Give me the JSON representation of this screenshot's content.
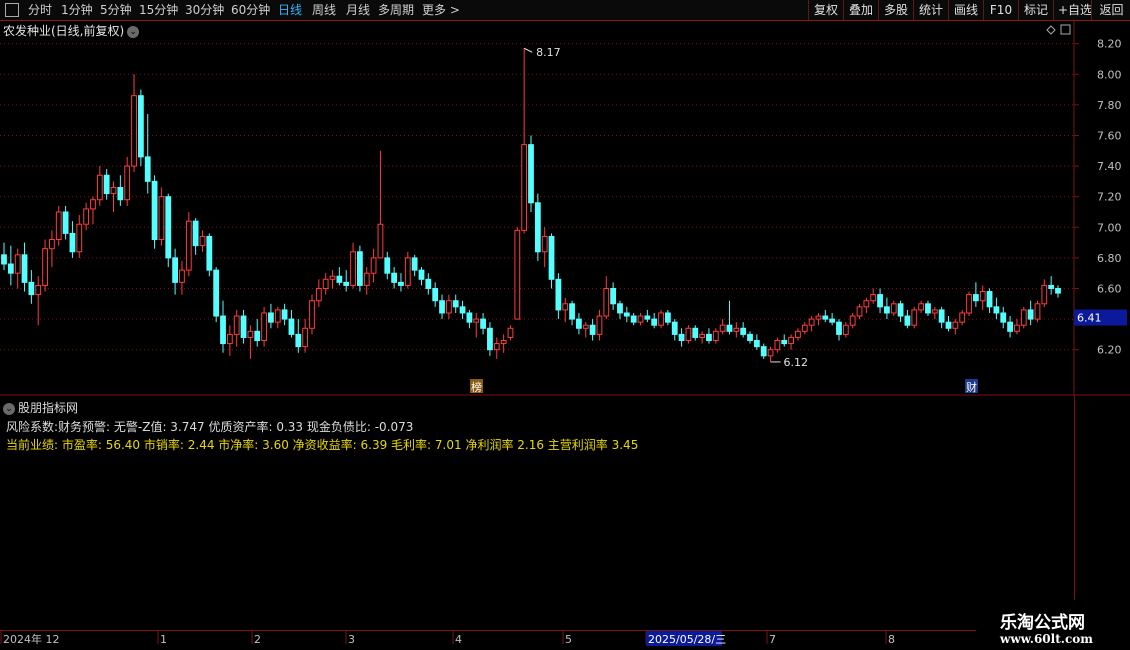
{
  "toolbar": {
    "periods": [
      "分时",
      "1分钟",
      "5分钟",
      "15分钟",
      "30分钟",
      "60分钟",
      "日线",
      "周线",
      "月线",
      "多周期",
      "更多 >"
    ],
    "active_period": "日线",
    "right_buttons": [
      "复权",
      "叠加",
      "多股",
      "统计",
      "画线",
      "F10",
      "标记",
      "+自选",
      "返回"
    ]
  },
  "chart": {
    "title": "农发种业(日线,前复权)",
    "price_axis": [
      "8.20",
      "8.00",
      "7.80",
      "7.60",
      "7.40",
      "7.20",
      "7.00",
      "6.80",
      "6.60",
      "6.40",
      "6.20"
    ],
    "current_price": "6.41",
    "high_label": "8.17",
    "low_label": "6.12",
    "marker_bang": "榜",
    "marker_cai": "财"
  },
  "indicator": {
    "title": "股朋指标网",
    "risk_line": "风险系数:财务预警: 无警-Z值: 3.747 优质资产率: 0.33 现金负债比: -0.073",
    "perf_line": "当前业绩: 市盈率: 56.40 市销率: 2.44 市净率: 3.60 净资收益率: 6.39 毛利率: 7.01 净利润率 2.16 主营利润率 3.45"
  },
  "time_axis": {
    "labels": [
      "2024年 12",
      "1",
      "2",
      "3",
      "4",
      "5",
      "2025/05/28/三",
      "7",
      "8"
    ],
    "highlight": "2025/05/28/三"
  },
  "watermark": {
    "title": "乐淘公式网",
    "url": "www.60lt.com"
  },
  "colors": {
    "up": "#ff3c3c",
    "down": "#54ffff",
    "grid": "#7a1414",
    "active": "#33b5ff",
    "perf": "#e8d800"
  },
  "chart_data": {
    "type": "candlestick",
    "ylim": [
      6.1,
      8.25
    ],
    "candles": [
      {
        "o": 6.82,
        "h": 6.9,
        "l": 6.72,
        "c": 6.76
      },
      {
        "o": 6.76,
        "h": 6.88,
        "l": 6.62,
        "c": 6.7
      },
      {
        "o": 6.7,
        "h": 6.86,
        "l": 6.6,
        "c": 6.82
      },
      {
        "o": 6.82,
        "h": 6.9,
        "l": 6.58,
        "c": 6.64
      },
      {
        "o": 6.64,
        "h": 6.72,
        "l": 6.5,
        "c": 6.56
      },
      {
        "o": 6.56,
        "h": 6.68,
        "l": 6.36,
        "c": 6.62
      },
      {
        "o": 6.62,
        "h": 6.92,
        "l": 6.58,
        "c": 6.86
      },
      {
        "o": 6.86,
        "h": 6.98,
        "l": 6.74,
        "c": 6.92
      },
      {
        "o": 6.92,
        "h": 7.14,
        "l": 6.88,
        "c": 7.1
      },
      {
        "o": 7.1,
        "h": 7.14,
        "l": 6.92,
        "c": 6.96
      },
      {
        "o": 6.96,
        "h": 7.04,
        "l": 6.8,
        "c": 6.84
      },
      {
        "o": 6.84,
        "h": 7.08,
        "l": 6.8,
        "c": 7.02
      },
      {
        "o": 7.02,
        "h": 7.16,
        "l": 6.98,
        "c": 7.12
      },
      {
        "o": 7.12,
        "h": 7.2,
        "l": 7.02,
        "c": 7.18
      },
      {
        "o": 7.18,
        "h": 7.4,
        "l": 7.14,
        "c": 7.34
      },
      {
        "o": 7.34,
        "h": 7.38,
        "l": 7.18,
        "c": 7.22
      },
      {
        "o": 7.22,
        "h": 7.3,
        "l": 7.1,
        "c": 7.26
      },
      {
        "o": 7.26,
        "h": 7.34,
        "l": 7.14,
        "c": 7.18
      },
      {
        "o": 7.18,
        "h": 7.46,
        "l": 7.14,
        "c": 7.4
      },
      {
        "o": 7.4,
        "h": 8.0,
        "l": 7.36,
        "c": 7.86
      },
      {
        "o": 7.86,
        "h": 7.9,
        "l": 7.4,
        "c": 7.46
      },
      {
        "o": 7.46,
        "h": 7.74,
        "l": 7.22,
        "c": 7.3
      },
      {
        "o": 7.3,
        "h": 7.34,
        "l": 6.86,
        "c": 6.92
      },
      {
        "o": 6.92,
        "h": 7.26,
        "l": 6.88,
        "c": 7.2
      },
      {
        "o": 7.2,
        "h": 7.22,
        "l": 6.74,
        "c": 6.8
      },
      {
        "o": 6.8,
        "h": 6.86,
        "l": 6.56,
        "c": 6.64
      },
      {
        "o": 6.64,
        "h": 6.78,
        "l": 6.56,
        "c": 6.72
      },
      {
        "o": 6.72,
        "h": 7.1,
        "l": 6.68,
        "c": 7.04
      },
      {
        "o": 7.04,
        "h": 7.06,
        "l": 6.82,
        "c": 6.88
      },
      {
        "o": 6.88,
        "h": 6.98,
        "l": 6.84,
        "c": 6.94
      },
      {
        "o": 6.94,
        "h": 6.96,
        "l": 6.68,
        "c": 6.72
      },
      {
        "o": 6.72,
        "h": 6.74,
        "l": 6.38,
        "c": 6.42
      },
      {
        "o": 6.42,
        "h": 6.52,
        "l": 6.18,
        "c": 6.24
      },
      {
        "o": 6.24,
        "h": 6.36,
        "l": 6.16,
        "c": 6.3
      },
      {
        "o": 6.3,
        "h": 6.46,
        "l": 6.22,
        "c": 6.42
      },
      {
        "o": 6.42,
        "h": 6.46,
        "l": 6.24,
        "c": 6.28
      },
      {
        "o": 6.28,
        "h": 6.36,
        "l": 6.14,
        "c": 6.32
      },
      {
        "o": 6.32,
        "h": 6.4,
        "l": 6.22,
        "c": 6.26
      },
      {
        "o": 6.26,
        "h": 6.48,
        "l": 6.22,
        "c": 6.44
      },
      {
        "o": 6.44,
        "h": 6.5,
        "l": 6.34,
        "c": 6.38
      },
      {
        "o": 6.38,
        "h": 6.48,
        "l": 6.34,
        "c": 6.46
      },
      {
        "o": 6.46,
        "h": 6.5,
        "l": 6.36,
        "c": 6.4
      },
      {
        "o": 6.4,
        "h": 6.46,
        "l": 6.28,
        "c": 6.3
      },
      {
        "o": 6.3,
        "h": 6.4,
        "l": 6.18,
        "c": 6.22
      },
      {
        "o": 6.22,
        "h": 6.4,
        "l": 6.18,
        "c": 6.34
      },
      {
        "o": 6.34,
        "h": 6.56,
        "l": 6.3,
        "c": 6.52
      },
      {
        "o": 6.52,
        "h": 6.66,
        "l": 6.48,
        "c": 6.6
      },
      {
        "o": 6.6,
        "h": 6.7,
        "l": 6.56,
        "c": 6.66
      },
      {
        "o": 6.66,
        "h": 6.72,
        "l": 6.6,
        "c": 6.68
      },
      {
        "o": 6.68,
        "h": 6.74,
        "l": 6.62,
        "c": 6.64
      },
      {
        "o": 6.64,
        "h": 6.72,
        "l": 6.58,
        "c": 6.62
      },
      {
        "o": 6.62,
        "h": 6.9,
        "l": 6.6,
        "c": 6.84
      },
      {
        "o": 6.84,
        "h": 6.88,
        "l": 6.58,
        "c": 6.62
      },
      {
        "o": 6.62,
        "h": 6.74,
        "l": 6.56,
        "c": 6.7
      },
      {
        "o": 6.7,
        "h": 6.86,
        "l": 6.64,
        "c": 6.8
      },
      {
        "o": 6.8,
        "h": 7.5,
        "l": 6.96,
        "c": 7.02
      },
      {
        "o": 6.8,
        "h": 6.84,
        "l": 6.66,
        "c": 6.7
      },
      {
        "o": 6.7,
        "h": 6.74,
        "l": 6.6,
        "c": 6.64
      },
      {
        "o": 6.64,
        "h": 6.7,
        "l": 6.58,
        "c": 6.62
      },
      {
        "o": 6.62,
        "h": 6.84,
        "l": 6.6,
        "c": 6.8
      },
      {
        "o": 6.8,
        "h": 6.82,
        "l": 6.68,
        "c": 6.72
      },
      {
        "o": 6.72,
        "h": 6.74,
        "l": 6.62,
        "c": 6.66
      },
      {
        "o": 6.66,
        "h": 6.7,
        "l": 6.56,
        "c": 6.6
      },
      {
        "o": 6.6,
        "h": 6.64,
        "l": 6.48,
        "c": 6.52
      },
      {
        "o": 6.52,
        "h": 6.56,
        "l": 6.4,
        "c": 6.44
      },
      {
        "o": 6.44,
        "h": 6.56,
        "l": 6.4,
        "c": 6.52
      },
      {
        "o": 6.52,
        "h": 6.56,
        "l": 6.44,
        "c": 6.48
      },
      {
        "o": 6.48,
        "h": 6.52,
        "l": 6.4,
        "c": 6.44
      },
      {
        "o": 6.44,
        "h": 6.46,
        "l": 6.34,
        "c": 6.38
      },
      {
        "o": 6.38,
        "h": 6.44,
        "l": 6.28,
        "c": 6.4
      },
      {
        "o": 6.4,
        "h": 6.44,
        "l": 6.3,
        "c": 6.34
      },
      {
        "o": 6.34,
        "h": 6.38,
        "l": 6.16,
        "c": 6.2
      },
      {
        "o": 6.2,
        "h": 6.28,
        "l": 6.14,
        "c": 6.24
      },
      {
        "o": 6.24,
        "h": 6.3,
        "l": 6.18,
        "c": 6.26
      },
      {
        "o": 6.28,
        "h": 6.36,
        "l": 6.26,
        "c": 6.34
      },
      {
        "o": 6.4,
        "h": 7.0,
        "l": 6.4,
        "c": 6.98
      },
      {
        "o": 6.98,
        "h": 8.17,
        "l": 6.96,
        "c": 7.54
      },
      {
        "o": 7.54,
        "h": 7.6,
        "l": 7.1,
        "c": 7.16
      },
      {
        "o": 7.16,
        "h": 7.22,
        "l": 6.78,
        "c": 6.84
      },
      {
        "o": 6.84,
        "h": 7.0,
        "l": 6.74,
        "c": 6.94
      },
      {
        "o": 6.94,
        "h": 6.96,
        "l": 6.6,
        "c": 6.66
      },
      {
        "o": 6.66,
        "h": 6.7,
        "l": 6.4,
        "c": 6.46
      },
      {
        "o": 6.46,
        "h": 6.54,
        "l": 6.38,
        "c": 6.5
      },
      {
        "o": 6.5,
        "h": 6.52,
        "l": 6.36,
        "c": 6.4
      },
      {
        "o": 6.4,
        "h": 6.44,
        "l": 6.3,
        "c": 6.34
      },
      {
        "o": 6.34,
        "h": 6.38,
        "l": 6.28,
        "c": 6.36
      },
      {
        "o": 6.36,
        "h": 6.4,
        "l": 6.26,
        "c": 6.3
      },
      {
        "o": 6.3,
        "h": 6.46,
        "l": 6.26,
        "c": 6.42
      },
      {
        "o": 6.42,
        "h": 6.68,
        "l": 6.4,
        "c": 6.6
      },
      {
        "o": 6.6,
        "h": 6.64,
        "l": 6.46,
        "c": 6.5
      },
      {
        "o": 6.5,
        "h": 6.52,
        "l": 6.4,
        "c": 6.44
      },
      {
        "o": 6.44,
        "h": 6.48,
        "l": 6.38,
        "c": 6.42
      },
      {
        "o": 6.42,
        "h": 6.44,
        "l": 6.36,
        "c": 6.38
      },
      {
        "o": 6.38,
        "h": 6.44,
        "l": 6.36,
        "c": 6.42
      },
      {
        "o": 6.42,
        "h": 6.46,
        "l": 6.38,
        "c": 6.4
      },
      {
        "o": 6.4,
        "h": 6.44,
        "l": 6.34,
        "c": 6.36
      },
      {
        "o": 6.36,
        "h": 6.46,
        "l": 6.34,
        "c": 6.44
      },
      {
        "o": 6.44,
        "h": 6.46,
        "l": 6.36,
        "c": 6.38
      },
      {
        "o": 6.38,
        "h": 6.4,
        "l": 6.26,
        "c": 6.3
      },
      {
        "o": 6.3,
        "h": 6.34,
        "l": 6.22,
        "c": 6.26
      },
      {
        "o": 6.26,
        "h": 6.36,
        "l": 6.24,
        "c": 6.34
      },
      {
        "o": 6.34,
        "h": 6.36,
        "l": 6.26,
        "c": 6.28
      },
      {
        "o": 6.28,
        "h": 6.32,
        "l": 6.24,
        "c": 6.3
      },
      {
        "o": 6.3,
        "h": 6.34,
        "l": 6.24,
        "c": 6.26
      },
      {
        "o": 6.26,
        "h": 6.34,
        "l": 6.24,
        "c": 6.32
      },
      {
        "o": 6.32,
        "h": 6.4,
        "l": 6.3,
        "c": 6.36
      },
      {
        "o": 6.36,
        "h": 6.52,
        "l": 6.3,
        "c": 6.32
      },
      {
        "o": 6.32,
        "h": 6.38,
        "l": 6.28,
        "c": 6.34
      },
      {
        "o": 6.34,
        "h": 6.38,
        "l": 6.28,
        "c": 6.3
      },
      {
        "o": 6.3,
        "h": 6.32,
        "l": 6.24,
        "c": 6.26
      },
      {
        "o": 6.26,
        "h": 6.3,
        "l": 6.2,
        "c": 6.22
      },
      {
        "o": 6.22,
        "h": 6.24,
        "l": 6.14,
        "c": 6.16
      },
      {
        "o": 6.16,
        "h": 6.22,
        "l": 6.12,
        "c": 6.2
      },
      {
        "o": 6.2,
        "h": 6.28,
        "l": 6.18,
        "c": 6.26
      },
      {
        "o": 6.26,
        "h": 6.3,
        "l": 6.22,
        "c": 6.24
      },
      {
        "o": 6.24,
        "h": 6.3,
        "l": 6.2,
        "c": 6.28
      },
      {
        "o": 6.28,
        "h": 6.34,
        "l": 6.26,
        "c": 6.32
      },
      {
        "o": 6.32,
        "h": 6.38,
        "l": 6.3,
        "c": 6.36
      },
      {
        "o": 6.36,
        "h": 6.42,
        "l": 6.32,
        "c": 6.4
      },
      {
        "o": 6.4,
        "h": 6.44,
        "l": 6.36,
        "c": 6.42
      },
      {
        "o": 6.42,
        "h": 6.46,
        "l": 6.38,
        "c": 6.4
      },
      {
        "o": 6.4,
        "h": 6.44,
        "l": 6.36,
        "c": 6.38
      },
      {
        "o": 6.38,
        "h": 6.4,
        "l": 6.26,
        "c": 6.3
      },
      {
        "o": 6.3,
        "h": 6.38,
        "l": 6.28,
        "c": 6.36
      },
      {
        "o": 6.36,
        "h": 6.44,
        "l": 6.34,
        "c": 6.42
      },
      {
        "o": 6.42,
        "h": 6.5,
        "l": 6.4,
        "c": 6.48
      },
      {
        "o": 6.48,
        "h": 6.54,
        "l": 6.44,
        "c": 6.52
      },
      {
        "o": 6.52,
        "h": 6.6,
        "l": 6.5,
        "c": 6.56
      },
      {
        "o": 6.56,
        "h": 6.6,
        "l": 6.44,
        "c": 6.48
      },
      {
        "o": 6.48,
        "h": 6.54,
        "l": 6.4,
        "c": 6.44
      },
      {
        "o": 6.44,
        "h": 6.52,
        "l": 6.42,
        "c": 6.5
      },
      {
        "o": 6.5,
        "h": 6.52,
        "l": 6.38,
        "c": 6.42
      },
      {
        "o": 6.42,
        "h": 6.46,
        "l": 6.34,
        "c": 6.36
      },
      {
        "o": 6.36,
        "h": 6.48,
        "l": 6.34,
        "c": 6.46
      },
      {
        "o": 6.46,
        "h": 6.52,
        "l": 6.44,
        "c": 6.5
      },
      {
        "o": 6.5,
        "h": 6.52,
        "l": 6.42,
        "c": 6.44
      },
      {
        "o": 6.44,
        "h": 6.48,
        "l": 6.4,
        "c": 6.46
      },
      {
        "o": 6.46,
        "h": 6.48,
        "l": 6.34,
        "c": 6.38
      },
      {
        "o": 6.38,
        "h": 6.42,
        "l": 6.32,
        "c": 6.34
      },
      {
        "o": 6.34,
        "h": 6.4,
        "l": 6.3,
        "c": 6.38
      },
      {
        "o": 6.38,
        "h": 6.46,
        "l": 6.36,
        "c": 6.44
      },
      {
        "o": 6.44,
        "h": 6.58,
        "l": 6.42,
        "c": 6.56
      },
      {
        "o": 6.56,
        "h": 6.64,
        "l": 6.48,
        "c": 6.52
      },
      {
        "o": 6.52,
        "h": 6.62,
        "l": 6.46,
        "c": 6.58
      },
      {
        "o": 6.58,
        "h": 6.6,
        "l": 6.44,
        "c": 6.48
      },
      {
        "o": 6.48,
        "h": 6.54,
        "l": 6.4,
        "c": 6.44
      },
      {
        "o": 6.44,
        "h": 6.48,
        "l": 6.34,
        "c": 6.38
      },
      {
        "o": 6.38,
        "h": 6.42,
        "l": 6.28,
        "c": 6.32
      },
      {
        "o": 6.32,
        "h": 6.4,
        "l": 6.3,
        "c": 6.36
      },
      {
        "o": 6.36,
        "h": 6.48,
        "l": 6.34,
        "c": 6.46
      },
      {
        "o": 6.46,
        "h": 6.52,
        "l": 6.36,
        "c": 6.4
      },
      {
        "o": 6.4,
        "h": 6.52,
        "l": 6.38,
        "c": 6.5
      },
      {
        "o": 6.5,
        "h": 6.66,
        "l": 6.48,
        "c": 6.62
      },
      {
        "o": 6.62,
        "h": 6.68,
        "l": 6.56,
        "c": 6.6
      },
      {
        "o": 6.6,
        "h": 6.62,
        "l": 6.54,
        "c": 6.57
      }
    ]
  }
}
